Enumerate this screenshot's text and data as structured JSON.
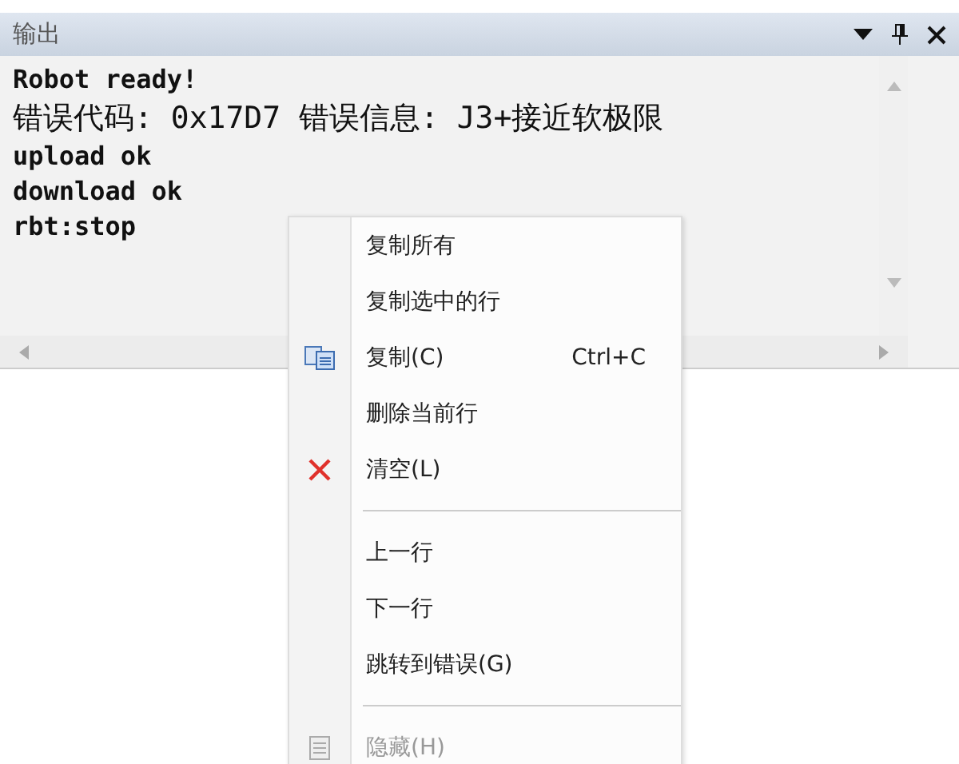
{
  "panel": {
    "title": "输出",
    "lines": [
      "Robot ready!",
      "错误代码: 0x17D7 错误信息: J3+接近软极限",
      "upload ok",
      "download ok",
      "rbt:stop"
    ]
  },
  "context_menu": [
    {
      "kind": "item",
      "label": "复制所有",
      "disabled": false
    },
    {
      "kind": "item",
      "label": "复制选中的行",
      "disabled": false
    },
    {
      "kind": "copy",
      "label": "复制(C)",
      "shortcut": "Ctrl+C",
      "disabled": false
    },
    {
      "kind": "item",
      "label": "删除当前行",
      "disabled": false
    },
    {
      "kind": "clear",
      "label": "清空(L)",
      "disabled": false
    },
    {
      "kind": "separator"
    },
    {
      "kind": "item",
      "label": "上一行",
      "disabled": false
    },
    {
      "kind": "item",
      "label": "下一行",
      "disabled": false
    },
    {
      "kind": "item",
      "label": "跳转到错误(G)",
      "disabled": false
    },
    {
      "kind": "separator"
    },
    {
      "kind": "hide",
      "label": "隐藏(H)",
      "disabled": true
    }
  ]
}
